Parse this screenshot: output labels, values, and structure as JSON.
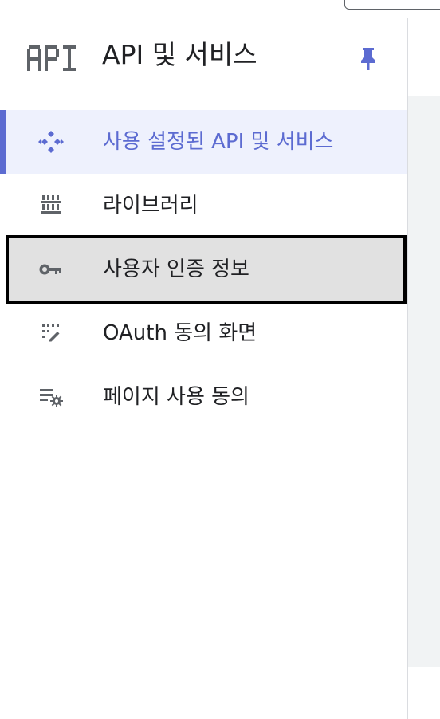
{
  "header": {
    "logo_text": "API",
    "title": "API 및 서비스"
  },
  "colors": {
    "accent": "#5c6bd1",
    "active_background": "#eef1fd",
    "focused_background": "#e1e1e1",
    "icon_grey": "#5f6368"
  },
  "nav": {
    "items": [
      {
        "label": "사용 설정된 API 및 서비스",
        "icon": "api-diamond-icon",
        "state": "active"
      },
      {
        "label": "라이브러리",
        "icon": "library-icon",
        "state": "normal"
      },
      {
        "label": "사용자 인증 정보",
        "icon": "key-icon",
        "state": "focused"
      },
      {
        "label": "OAuth 동의 화면",
        "icon": "oauth-consent-icon",
        "state": "normal"
      },
      {
        "label": "페이지 사용 동의",
        "icon": "page-usage-settings-icon",
        "state": "normal"
      }
    ]
  }
}
